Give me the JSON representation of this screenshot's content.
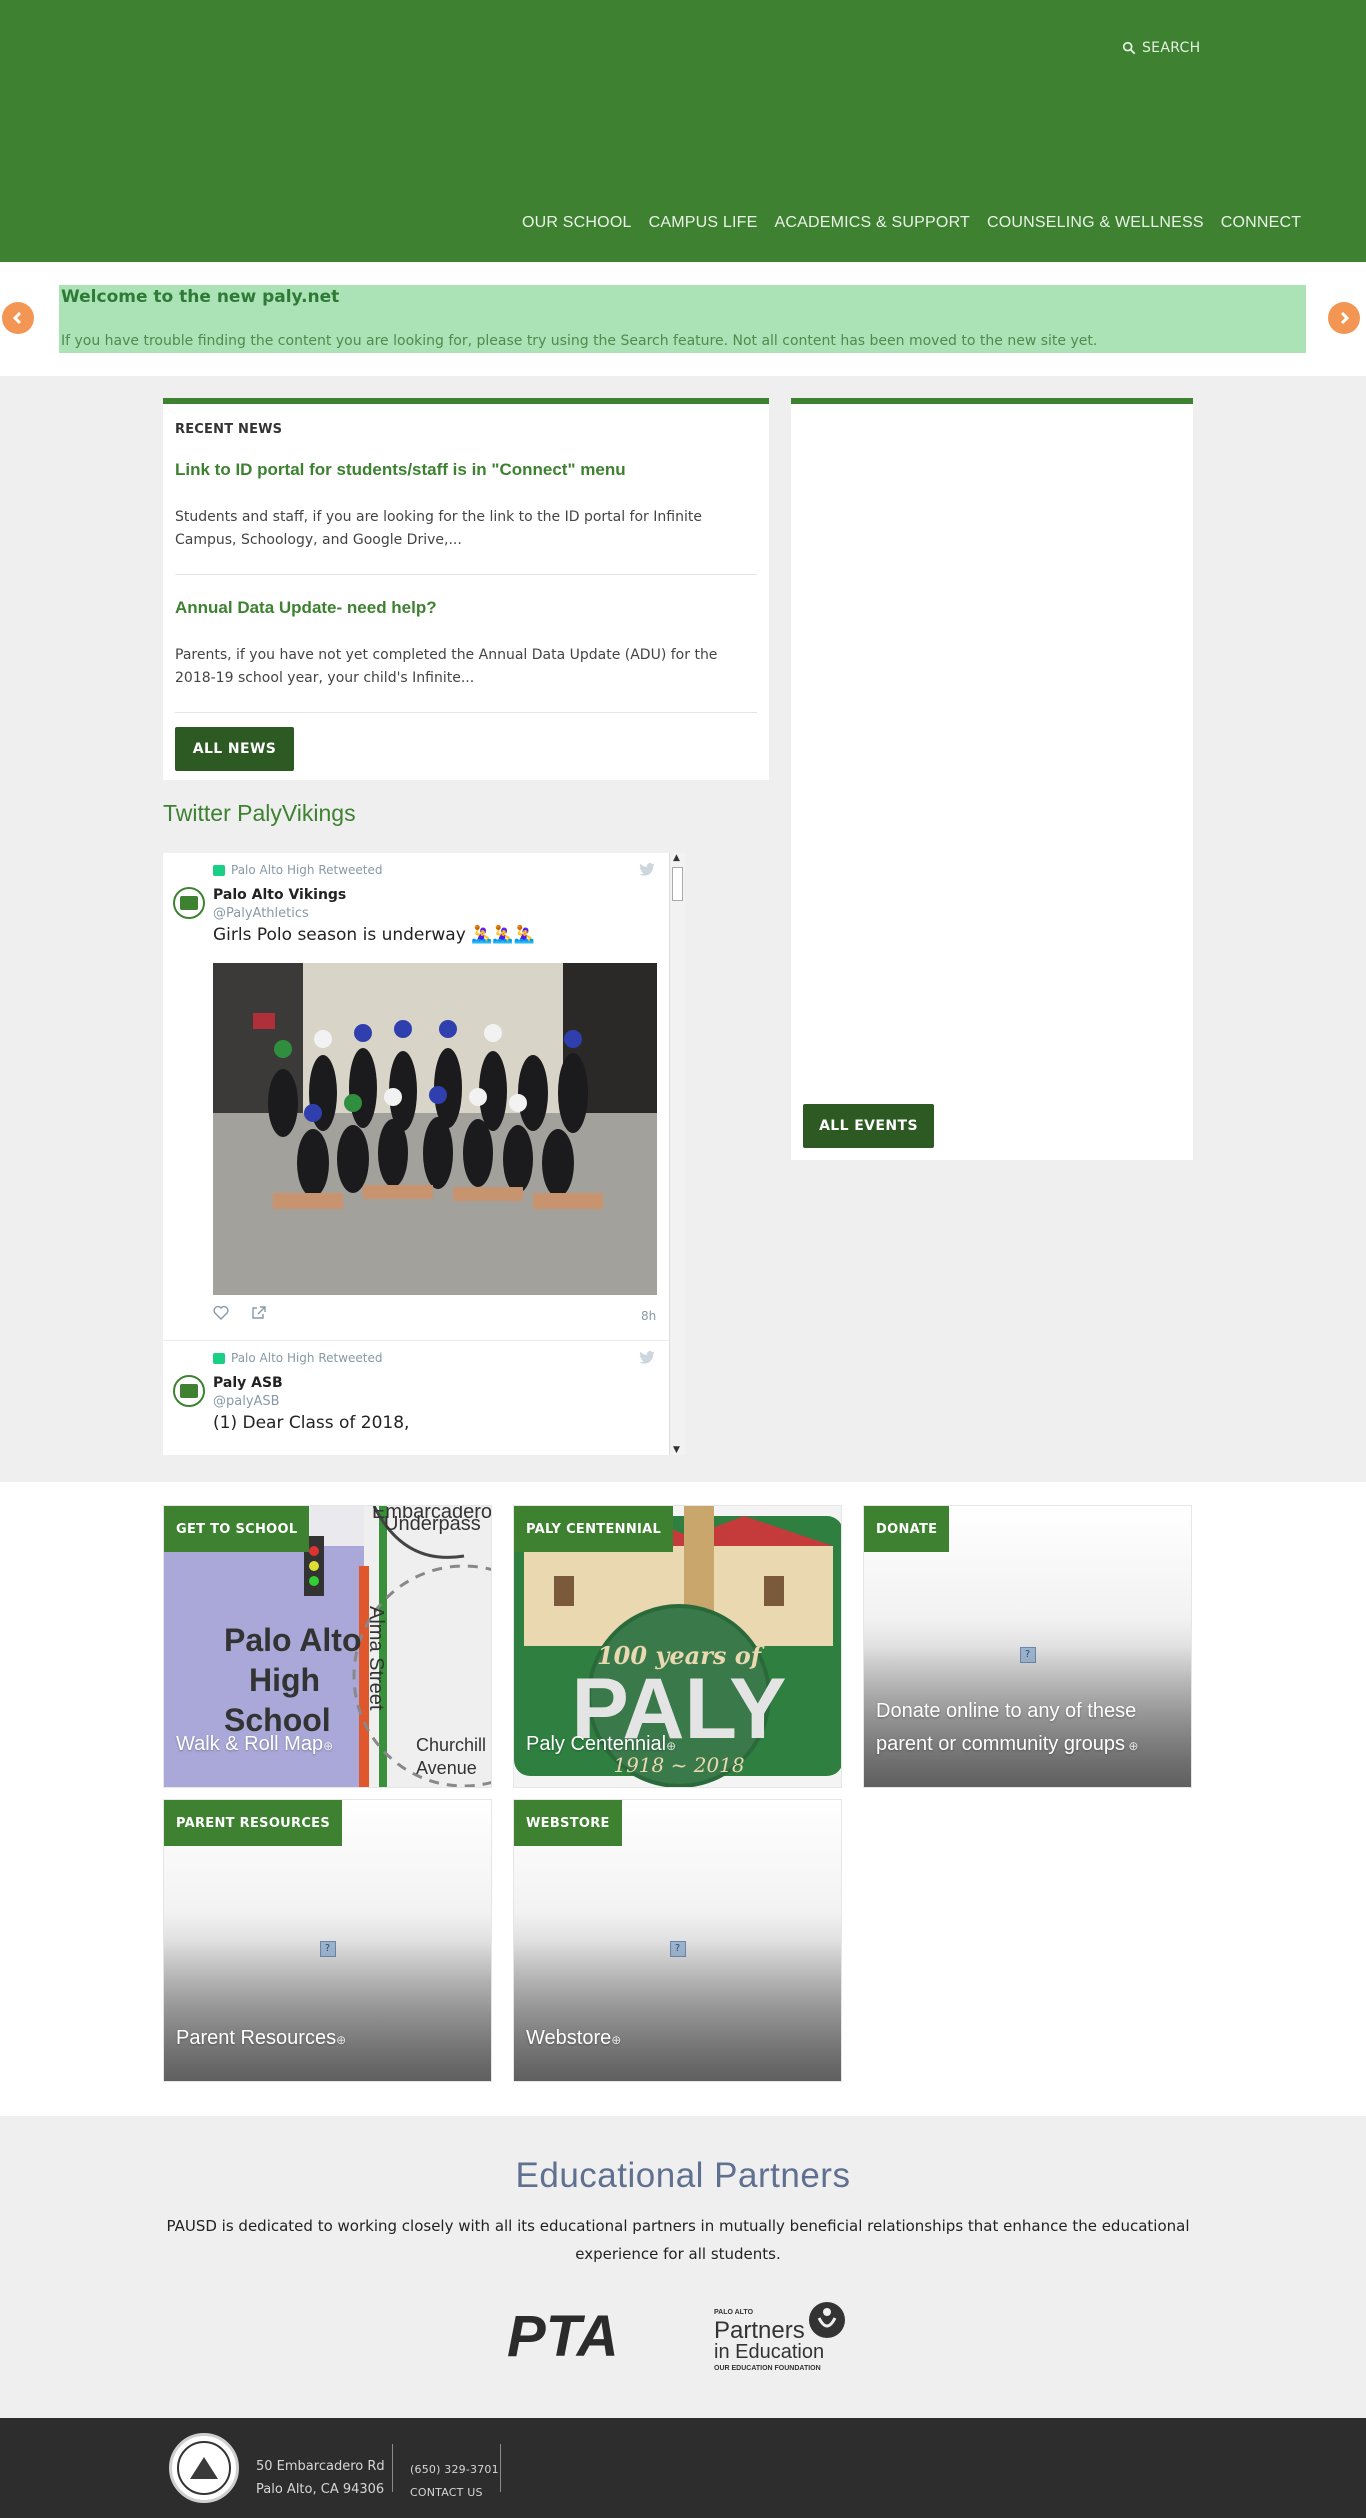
{
  "header": {
    "search_label": "SEARCH",
    "nav": [
      "OUR SCHOOL",
      "CAMPUS LIFE",
      "ACADEMICS & SUPPORT",
      "COUNSELING & WELLNESS",
      "CONNECT"
    ]
  },
  "alert": {
    "title": "Welcome to the new paly.net",
    "text": "If you have trouble finding the content you are looking for, please try using the Search feature. Not all content has been moved to the new site yet."
  },
  "news": {
    "heading": "RECENT NEWS",
    "items": [
      {
        "title": "Link to ID portal for students/staff is in \"Connect\" menu",
        "summary": "Students and staff, if you are looking for the link to the ID portal for Infinite Campus, Schoology, and Google Drive,..."
      },
      {
        "title": "Annual Data Update- need help?",
        "summary": "Parents, if you have not yet completed the Annual Data Update (ADU) for the 2018-19 school year, your child's Infinite..."
      }
    ],
    "button": "ALL NEWS"
  },
  "events": {
    "button": "ALL EVENTS"
  },
  "twitter": {
    "title": "Twitter PalyVikings",
    "tweets": [
      {
        "retweet_label": "Palo Alto High Retweeted",
        "name": "Palo Alto Vikings",
        "handle": "@PalyAthletics",
        "text": "Girls Polo season is underway 🤽‍♀️🤽‍♀️🤽‍♀️",
        "time": "8h"
      },
      {
        "retweet_label": "Palo Alto High Retweeted",
        "name": "Paly ASB",
        "handle": "@palyASB",
        "text": "(1) Dear Class of 2018,"
      }
    ]
  },
  "tiles": [
    {
      "tag": "GET TO SCHOOL",
      "caption": "Walk & Roll Map"
    },
    {
      "tag": "PALY CENTENNIAL",
      "caption": "Paly Centennial"
    },
    {
      "tag": "DONATE",
      "caption": "Donate online to any of these parent or community groups"
    },
    {
      "tag": "PARENT RESOURCES",
      "caption": "Parent Resources"
    },
    {
      "tag": "WEBSTORE",
      "caption": "Webstore"
    }
  ],
  "map_art": {
    "street_top": "Embarcadero",
    "street_top2": "Underpass",
    "school_1": "Palo Alto",
    "school_2": "High",
    "school_3": "School",
    "alma": "Alma Street",
    "churchill_1": "Churchill",
    "churchill_2": "Avenue"
  },
  "centennial_art": {
    "years_line": "100 years of",
    "big": "PALY",
    "dates": "1918 ~ 2018"
  },
  "partners": {
    "title": "Educational Partners",
    "text": "PAUSD is dedicated to working closely with all its educational partners in mutually beneficial relationships that enhance the educational experience for all students.",
    "pta_logo": "PTA",
    "pie_small": "PALO ALTO",
    "pie_line1": "Partners",
    "pie_line2": "in Education",
    "pie_tag": "OUR EDUCATION FOUNDATION"
  },
  "footer": {
    "address_1": "50 Embarcadero Rd",
    "address_2": "Palo Alto, CA 94306",
    "phone": "(650) 329-3701",
    "contact": "CONTACT US"
  },
  "colors": {
    "brand_green": "#3d8131",
    "dark_green": "#2d5a23",
    "alert_bg": "#abe2b6",
    "arrow_orange": "#f39654"
  }
}
